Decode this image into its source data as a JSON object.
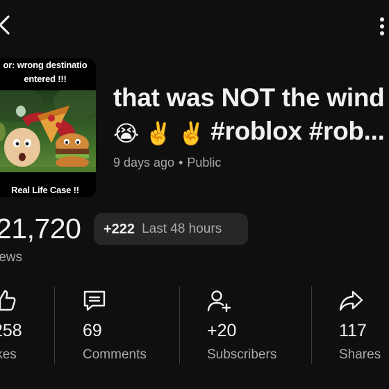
{
  "top_bar": {
    "back_icon": "chevron-left-icon",
    "more_icon": "more-vertical-icon"
  },
  "thumbnail": {
    "caption_top_line1": "or: wrong destinatio",
    "caption_top_line2": "entered !!!",
    "caption_bottom": "Real Life Case !!"
  },
  "video": {
    "title_line1": "that was NOT the wind",
    "title_line2_emojis": [
      "😭",
      "✌️",
      "✌️"
    ],
    "title_line2_text": "#roblox #rob...",
    "age": "9 days ago",
    "separator": "•",
    "visibility": "Public"
  },
  "views": {
    "count": "21,720",
    "label": "iews",
    "recent_delta": "+222",
    "recent_period": "Last 48 hours"
  },
  "stats": [
    {
      "icon": "thumbs-up-icon",
      "value": "258",
      "label": "ikes"
    },
    {
      "icon": "comment-icon",
      "value": "69",
      "label": "Comments"
    },
    {
      "icon": "person-add-icon",
      "value": "+20",
      "label": "Subscribers"
    },
    {
      "icon": "share-icon",
      "value": "117",
      "label": "Shares"
    }
  ]
}
